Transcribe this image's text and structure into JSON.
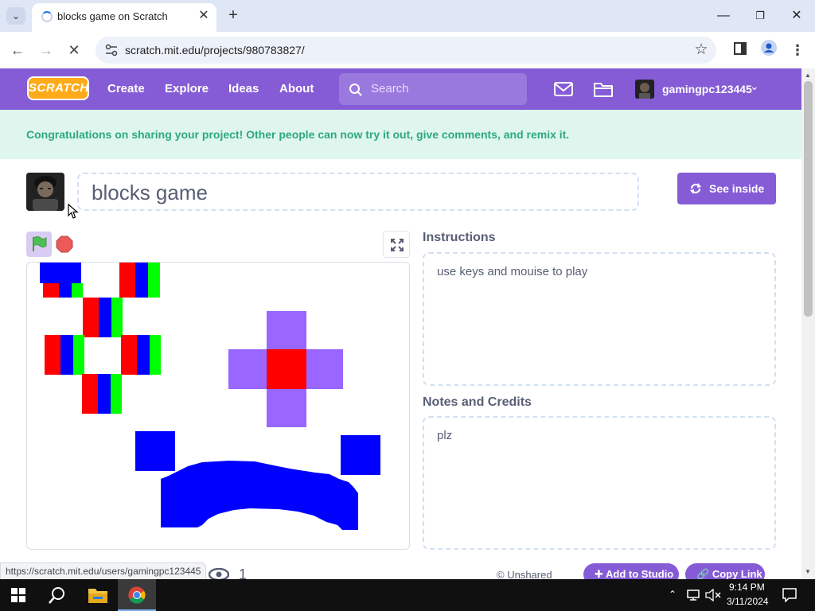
{
  "browser": {
    "tab_title": "blocks game on Scratch",
    "url": "scratch.mit.edu/projects/980783827/",
    "status_url": "https://scratch.mit.edu/users/gamingpc123445"
  },
  "nav": {
    "logo": "SCRATCH",
    "links": [
      "Create",
      "Explore",
      "Ideas",
      "About"
    ],
    "search_placeholder": "Search",
    "username": "gamingpc123445"
  },
  "banner": {
    "text": "Congratulations on sharing your project! Other people can now try it out, give comments, and remix it."
  },
  "project": {
    "title": "blocks game",
    "see_inside": "See inside",
    "instructions_title": "Instructions",
    "instructions": "use keys and mouise to play",
    "notes_title": "Notes and Credits",
    "notes": "plz",
    "view_count": "1",
    "share_status": "Unshared",
    "add_to_studio": "Add to Studio",
    "copy_link": "Copy Link"
  },
  "taskbar": {
    "time": "9:14 PM",
    "date": "3/11/2024"
  },
  "colors": {
    "scratch_purple": "#855cd6",
    "banner_bg": "#def6ee",
    "banner_text": "#2ea87d",
    "stage_blue": "#0000ff",
    "stage_red": "#ff0000",
    "stage_green": "#00ff00",
    "stage_lavender": "#9966ff"
  }
}
